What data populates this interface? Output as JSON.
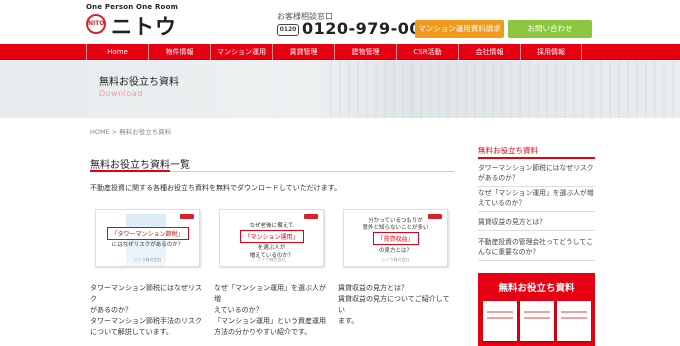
{
  "header": {
    "tagline": "One Person One Room",
    "logo_mark": "NITO",
    "logo_name": "ニトウ",
    "tel_caption": "お客様相談窓口",
    "tel_icon": "0120",
    "tel_number": "0120-979-001",
    "docs_button": "マンション運用資料請求",
    "contact_button": "お問い合わせ"
  },
  "nav": {
    "items": [
      "Home",
      "物件情報",
      "マンション運用",
      "賃貸管理",
      "建物管理",
      "CSR活動",
      "会社情報",
      "採用情報"
    ]
  },
  "banner": {
    "title": "無料お役立ち資料",
    "subtitle": "Download"
  },
  "breadcrumb": "HOME > 無料お役立ち資料",
  "main": {
    "title": "無料お役立ち資料一覧",
    "intro": "不動産投資に関する各種お役立ち資料を無料でダウンロードしていただけます。",
    "cards": [
      {
        "red_label": "「タワーマンション節税」",
        "line2": "にはなぜリスクがあるのか？",
        "footer": "ニトウ株式会社"
      },
      {
        "line1": "なぜ老後に備えて",
        "red_label": "「マンション運用」",
        "line2": "を選ぶ人が",
        "line3": "増えているのか？",
        "footer": "ニトウ株式会社"
      },
      {
        "line1": "分かっているつもりが",
        "line1b": "意外と知らないことが多い",
        "red_label": "「賃貸収益」",
        "line2": "の見方とは？",
        "footer": "ニトウ株式会社"
      }
    ],
    "descriptions": [
      [
        "タワーマンション節税にはなぜリスク",
        "があるのか？",
        "タワーマンション節税手法のリスク",
        "について解説しています。"
      ],
      [
        "なぜ「マンション運用」を選ぶ人が増",
        "えているのか？",
        "「マンション運用」という資産運用",
        "方法の分かりやすい紹介です。"
      ],
      [
        "賃貸収益の見方とは？",
        "賃貸収益の見方についてご紹介してい",
        "ます。"
      ]
    ]
  },
  "sidebar": {
    "heading": "無料お役立ち資料",
    "items": [
      "タワーマンション節税にはなぜリスクがあるのか？",
      "なぜ「マンション運用」を選ぶ人が増えているのか？",
      "賃貸収益の見方とは？",
      "不動産投資の管理会社ってどうしてこんなに重要なのか？"
    ],
    "banner_title": "無料お役立ち資料"
  },
  "colors": {
    "brand_red": "#e60012",
    "docs_orange": "#f29a1c",
    "contact_green": "#8cc63f"
  }
}
